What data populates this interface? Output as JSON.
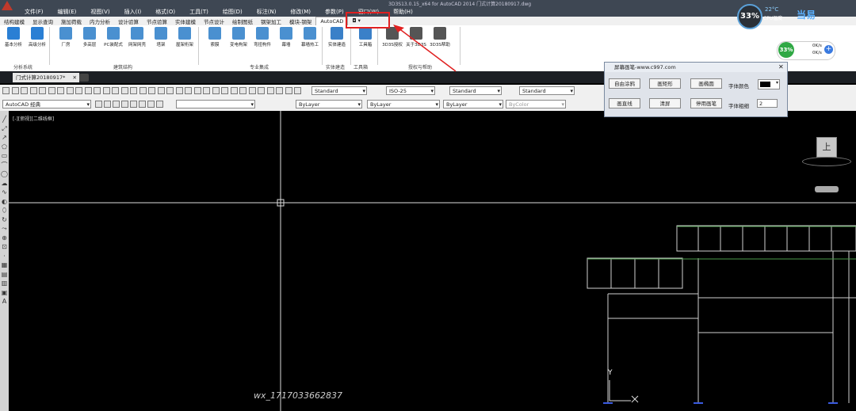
{
  "titlebar": {
    "title": "3D3S13.0.15_x64 for AutoCAD 2014   门式计算20180917.dwg"
  },
  "menu": [
    "文件(F)",
    "编辑(E)",
    "视图(V)",
    "插入(I)",
    "格式(O)",
    "工具(T)",
    "绘图(D)",
    "标注(N)",
    "修改(M)",
    "参数(P)",
    "窗口(W)",
    "帮助(H)"
  ],
  "ribbon_tabs": [
    "结构建模",
    "显示查询",
    "施加荷载",
    "内力分析",
    "设计验算",
    "节点验算",
    "实体建模",
    "节点设计",
    "绘制图纸",
    "钢架加工",
    "模块-钢架",
    "AutoCAD",
    "◘ ▾"
  ],
  "ribbon_active_tab": "AutoCAD",
  "ribbon_buttons": [
    {
      "label": "基本分析",
      "group": 0,
      "color": "#2a7fd4"
    },
    {
      "label": "高级分析",
      "group": 0,
      "color": "#2a7fd4"
    },
    {
      "label": "厂房",
      "group": 1,
      "color": "#4a90d0"
    },
    {
      "label": "多高层",
      "group": 1,
      "color": "#4a90d0"
    },
    {
      "label": "PC装配式",
      "group": 1,
      "color": "#4a90d0"
    },
    {
      "label": "网架网壳",
      "group": 1,
      "color": "#4a90d0"
    },
    {
      "label": "塔架",
      "group": 1,
      "color": "#4a90d0"
    },
    {
      "label": "屋架桁架",
      "group": 1,
      "color": "#4a90d0"
    },
    {
      "label": "索膜",
      "group": 2,
      "color": "#4a90d0"
    },
    {
      "label": "变电构架",
      "group": 2,
      "color": "#4a90d0"
    },
    {
      "label": "弯扭构件",
      "group": 2,
      "color": "#4a90d0"
    },
    {
      "label": "幕墙",
      "group": 2,
      "color": "#4a90d0"
    },
    {
      "label": "幕墙热工",
      "group": 2,
      "color": "#4a90d0"
    },
    {
      "label": "实体建造",
      "group": 3,
      "color": "#3a80c8"
    },
    {
      "label": "工具箱",
      "group": 4,
      "color": "#3a80c8"
    },
    {
      "label": "3D3S授权",
      "group": 5,
      "color": "#555555"
    },
    {
      "label": "关于3D3S",
      "group": 5,
      "color": "#555555"
    },
    {
      "label": "3D3S帮助",
      "group": 5,
      "color": "#555555"
    }
  ],
  "ribbon_groups": [
    "分析系统",
    "建筑结构",
    "专业集成",
    "实体建造",
    "工具箱",
    "授权与帮助"
  ],
  "file_tab": "门式计算20180917*",
  "toolbar1": {
    "text_style": "Standard",
    "dim_style": "ISO-25",
    "table_style": "Standard",
    "mleader_style": "Standard"
  },
  "toolbar2": {
    "workspace": "AutoCAD 经典",
    "layer": "",
    "color": "ByLayer",
    "linetype": "ByLayer",
    "lineweight": "ByLayer",
    "plotstyle": "ByColor"
  },
  "viewport_label": "[-][俯视][二维线框]",
  "watermark": "wx_17170336628​37",
  "y_axis_label": "Y",
  "cpu": {
    "percent": "33%",
    "temp": "22°C",
    "temp_label": "CPU温度",
    "brand": "当易"
  },
  "net": {
    "percent": "33%",
    "up": "0K/s",
    "down": "0K/s"
  },
  "viewcube": {
    "face": "上"
  },
  "palette": {
    "title": "屏幕画笔-www.c997.com",
    "buttons": [
      "自由涂鸦",
      "画矩形",
      "画椭圆",
      "画直线",
      "清屏",
      "停用画笔"
    ],
    "color_label": "字体颜色",
    "thickness_label": "字体粗细",
    "thickness_value": "2",
    "close": "✕"
  }
}
